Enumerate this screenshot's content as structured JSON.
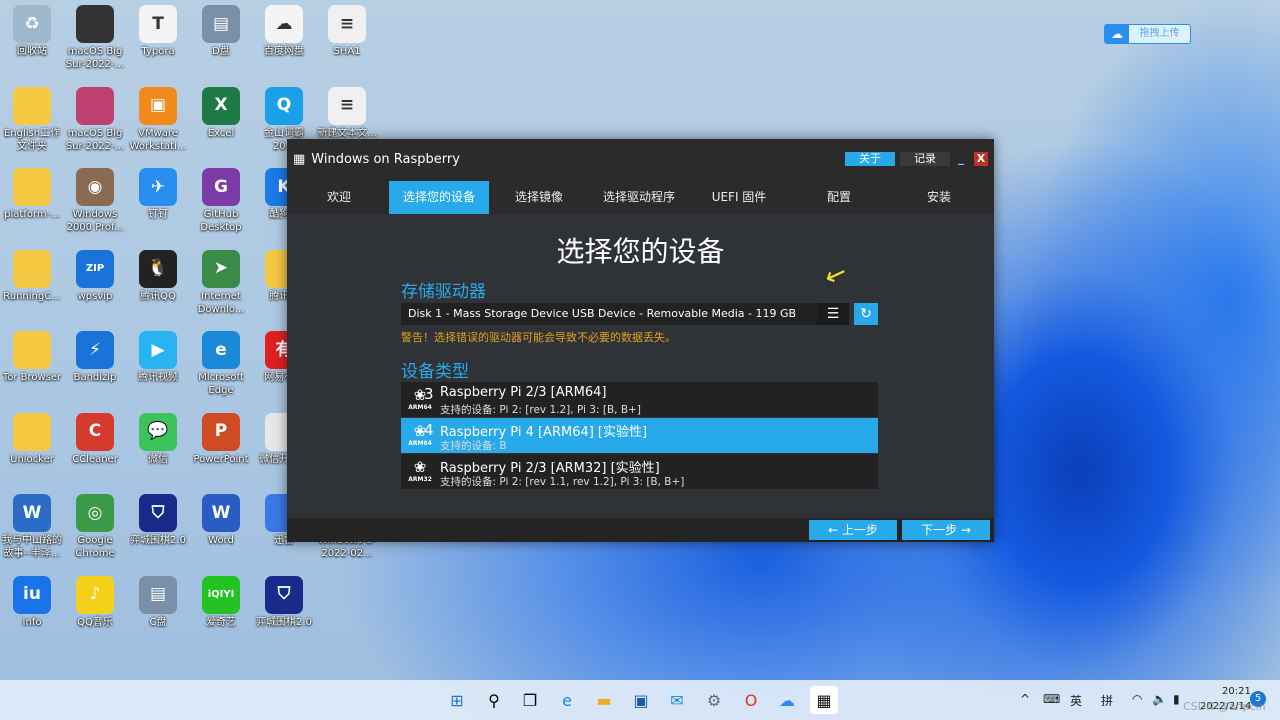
{
  "desktop": {
    "columns": [
      [
        {
          "label": "回收站",
          "glyph": "♻",
          "color": "#9fb8cc"
        },
        {
          "label": "English工作文件夹",
          "glyph": "",
          "color": "#f5c842"
        },
        {
          "label": "platform-...",
          "glyph": "",
          "color": "#f5c842"
        },
        {
          "label": "RunningC...",
          "glyph": "",
          "color": "#f5c842"
        },
        {
          "label": "Tor Browser",
          "glyph": "",
          "color": "#f5c842"
        },
        {
          "label": "Unlocker",
          "glyph": "",
          "color": "#f5c842"
        },
        {
          "label": "我与中山路的故事--丰泽...",
          "glyph": "W",
          "color": "#2b6cc4"
        },
        {
          "label": "Info",
          "glyph": "iu",
          "color": "#1a73e8"
        }
      ],
      [
        {
          "label": "macOS Big Sur-2022-...",
          "glyph": "",
          "color": "#333"
        },
        {
          "label": "macOS Big Sur-2022-...",
          "glyph": "",
          "color": "#c04070"
        },
        {
          "label": "Windows 2000 Prof...",
          "glyph": "◉",
          "color": "#8a6a50"
        },
        {
          "label": "wpsvip",
          "glyph": "ZIP",
          "color": "#1a73d8"
        },
        {
          "label": "Bandizip",
          "glyph": "⚡",
          "color": "#1a73d8"
        },
        {
          "label": "CCleaner",
          "glyph": "C",
          "color": "#d63a2a"
        },
        {
          "label": "Google Chrome",
          "glyph": "◎",
          "color": "#3a9a48"
        },
        {
          "label": "QQ音乐",
          "glyph": "♪",
          "color": "#f5d21a"
        }
      ],
      [
        {
          "label": "Typora",
          "glyph": "T",
          "color": "#f4f4f4"
        },
        {
          "label": "VMware Workstati...",
          "glyph": "▣",
          "color": "#f08a1a"
        },
        {
          "label": "钉钉",
          "glyph": "✈",
          "color": "#2a8ef0"
        },
        {
          "label": "腾讯QQ",
          "glyph": "🐧",
          "color": "#222"
        },
        {
          "label": "腾讯视频",
          "glyph": "▶",
          "color": "#28b4f0"
        },
        {
          "label": "微信",
          "glyph": "💬",
          "color": "#3cc35a"
        },
        {
          "label": "弈城围棋2.0",
          "glyph": "⛉",
          "color": "#1a2a8a"
        },
        {
          "label": "C盘",
          "glyph": "▤",
          "color": "#7a8fa8"
        }
      ],
      [
        {
          "label": "D盘",
          "glyph": "▤",
          "color": "#7a8fa8"
        },
        {
          "label": "Excel",
          "glyph": "X",
          "color": "#1d7a44"
        },
        {
          "label": "GitHub Desktop",
          "glyph": "G",
          "color": "#7a3aa8"
        },
        {
          "label": "Internet Downlo...",
          "glyph": "➤",
          "color": "#3a8a48"
        },
        {
          "label": "Microsoft Edge",
          "glyph": "e",
          "color": "#1a8ad8"
        },
        {
          "label": "PowerPoint",
          "glyph": "P",
          "color": "#d04a24"
        },
        {
          "label": "Word",
          "glyph": "W",
          "color": "#2b5cc4"
        },
        {
          "label": "爱奇艺",
          "glyph": "iQIYI",
          "color": "#22c322"
        }
      ],
      [
        {
          "label": "百度网盘",
          "glyph": "☁",
          "color": "#f4f4f4"
        },
        {
          "label": "金山词霸 20...",
          "glyph": "Q",
          "color": "#1aa0e8"
        },
        {
          "label": "酷狗...",
          "glyph": "K",
          "color": "#1a7ae8"
        },
        {
          "label": "腾讯...",
          "glyph": "",
          "color": "#f5c842"
        },
        {
          "label": "网易有...",
          "glyph": "有",
          "color": "#e02020"
        },
        {
          "label": "微信开...具",
          "glyph": "",
          "color": "#e8e8e8"
        },
        {
          "label": "迅雷",
          "glyph": "",
          "color": "#3a7ae8"
        },
        {
          "label": "弈城围棋2.0",
          "glyph": "⛉",
          "color": "#1a2a8a"
        }
      ],
      [
        {
          "label": "SHA1",
          "glyph": "≡",
          "color": "#f0f0f0"
        },
        {
          "label": "新建文本文...",
          "glyph": "≡",
          "color": "#f0f0f0"
        },
        null,
        null,
        null,
        null,
        {
          "label": "Windows 8-2022-02...",
          "glyph": "",
          "color": "transparent"
        },
        null
      ]
    ]
  },
  "upload_widget": {
    "label": "拖拽上传"
  },
  "window": {
    "title": "Windows on Raspberry",
    "about": "关于",
    "log": "记录",
    "minimize": "_",
    "close": "X",
    "tabs": [
      "欢迎",
      "选择您的设备",
      "选择镜像",
      "选择驱动程序",
      "UEFI 固件",
      "配置",
      "安装"
    ],
    "active_tab": 1,
    "heading": "选择您的设备",
    "storage_label": "存储驱动器",
    "disk": "Disk 1 - Mass Storage Device USB Device - Removable Media - 119 GB",
    "warning": "警告！选择错误的驱动器可能会导致不必要的数据丢失。",
    "device_type_label": "设备类型",
    "devices": [
      {
        "num": "3",
        "arch": "ARM64",
        "name": "Raspberry Pi 2/3 [ARM64]",
        "sub": "支持的设备: Pi 2: [rev 1.2], Pi 3: [B, B+]"
      },
      {
        "num": "4",
        "arch": "ARM64",
        "name": "Raspberry Pi 4 [ARM64] [实验性]",
        "sub": "支持的设备: B"
      },
      {
        "num": "",
        "arch": "ARM32",
        "name": "Raspberry Pi 2/3 [ARM32] [实验性]",
        "sub": "支持的设备: Pi 2: [rev 1.1, rev 1.2], Pi 3: [B, B+]"
      }
    ],
    "selected_device": 1,
    "prev": "← 上一步",
    "next": "下一步 →",
    "accent": "#28a9ea"
  },
  "taskbar": {
    "time": "20:21",
    "date": "2022/2/14",
    "lang1": "英",
    "lang2": "拼",
    "notification_count": "5",
    "watermark": "CSDN @ahpcin"
  }
}
